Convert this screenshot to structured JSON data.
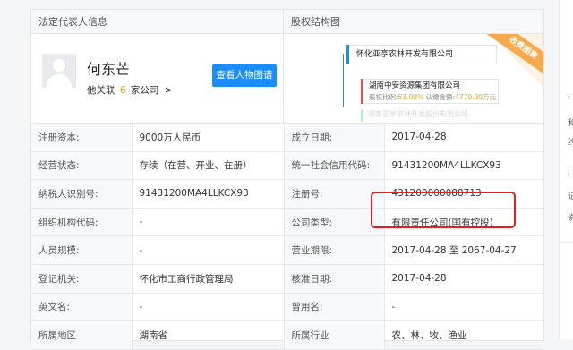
{
  "legal_rep": {
    "header": "法定代表人信息",
    "name": "何东芒",
    "related_prefix": "他关联",
    "related_count": "6",
    "related_suffix": "家公司",
    "related_arrow": ">",
    "chart_button": "查看人物图谱"
  },
  "equity": {
    "header": "股权结构图",
    "main_company": "怀化亚亨农林开发有限公司",
    "shareholder_name": "湖南中安资源集团有限公司",
    "shareholder_ratio_label": "股权比例:",
    "shareholder_ratio": "53.00%",
    "shareholder_capital_label": "认缴金额:",
    "shareholder_capital": "4770.00万元",
    "shareholder_faded": "湖南亚亨农林开发股份有限公司",
    "ribbon": "收费图表"
  },
  "info_rows": [
    {
      "l1": "注册资本:",
      "v1": "9000万人民币",
      "l2": "成立日期:",
      "v2": "2017-04-28"
    },
    {
      "l1": "经营状态:",
      "v1": "存续（在营、开业、在册）",
      "l2": "统一社会信用代码:",
      "v2": "91431200MA4LLKCX93"
    },
    {
      "l1": "纳税人识别号:",
      "v1": "91431200MA4LLKCX93",
      "l2": "注册号:",
      "v2": "431200000088713"
    },
    {
      "l1": "组织机构代码:",
      "v1": "-",
      "l2": "公司类型:",
      "v2": "有限责任公司(国有控股)"
    },
    {
      "l1": "人员规模:",
      "v1": "-",
      "l2": "营业期限:",
      "v2": "2017-04-28 至 2067-04-27"
    },
    {
      "l1": "登记机关:",
      "v1": "怀化市工商行政管理局",
      "l2": "核准日期:",
      "v2": "2017-04-28"
    },
    {
      "l1": "英文名:",
      "v1": "-",
      "l2": "曾用名:",
      "v2": "-"
    },
    {
      "l1": "所属地区",
      "v1": "湖南省",
      "l2": "所属行业",
      "v2": "农、林、牧、渔业"
    }
  ],
  "right_panel_glyphs": [
    "i",
    "和",
    "约",
    "i",
    "记",
    "说"
  ],
  "colors": {
    "accent": "#1a8cff",
    "highlight": "#e02020",
    "orange": "#f39c12"
  }
}
